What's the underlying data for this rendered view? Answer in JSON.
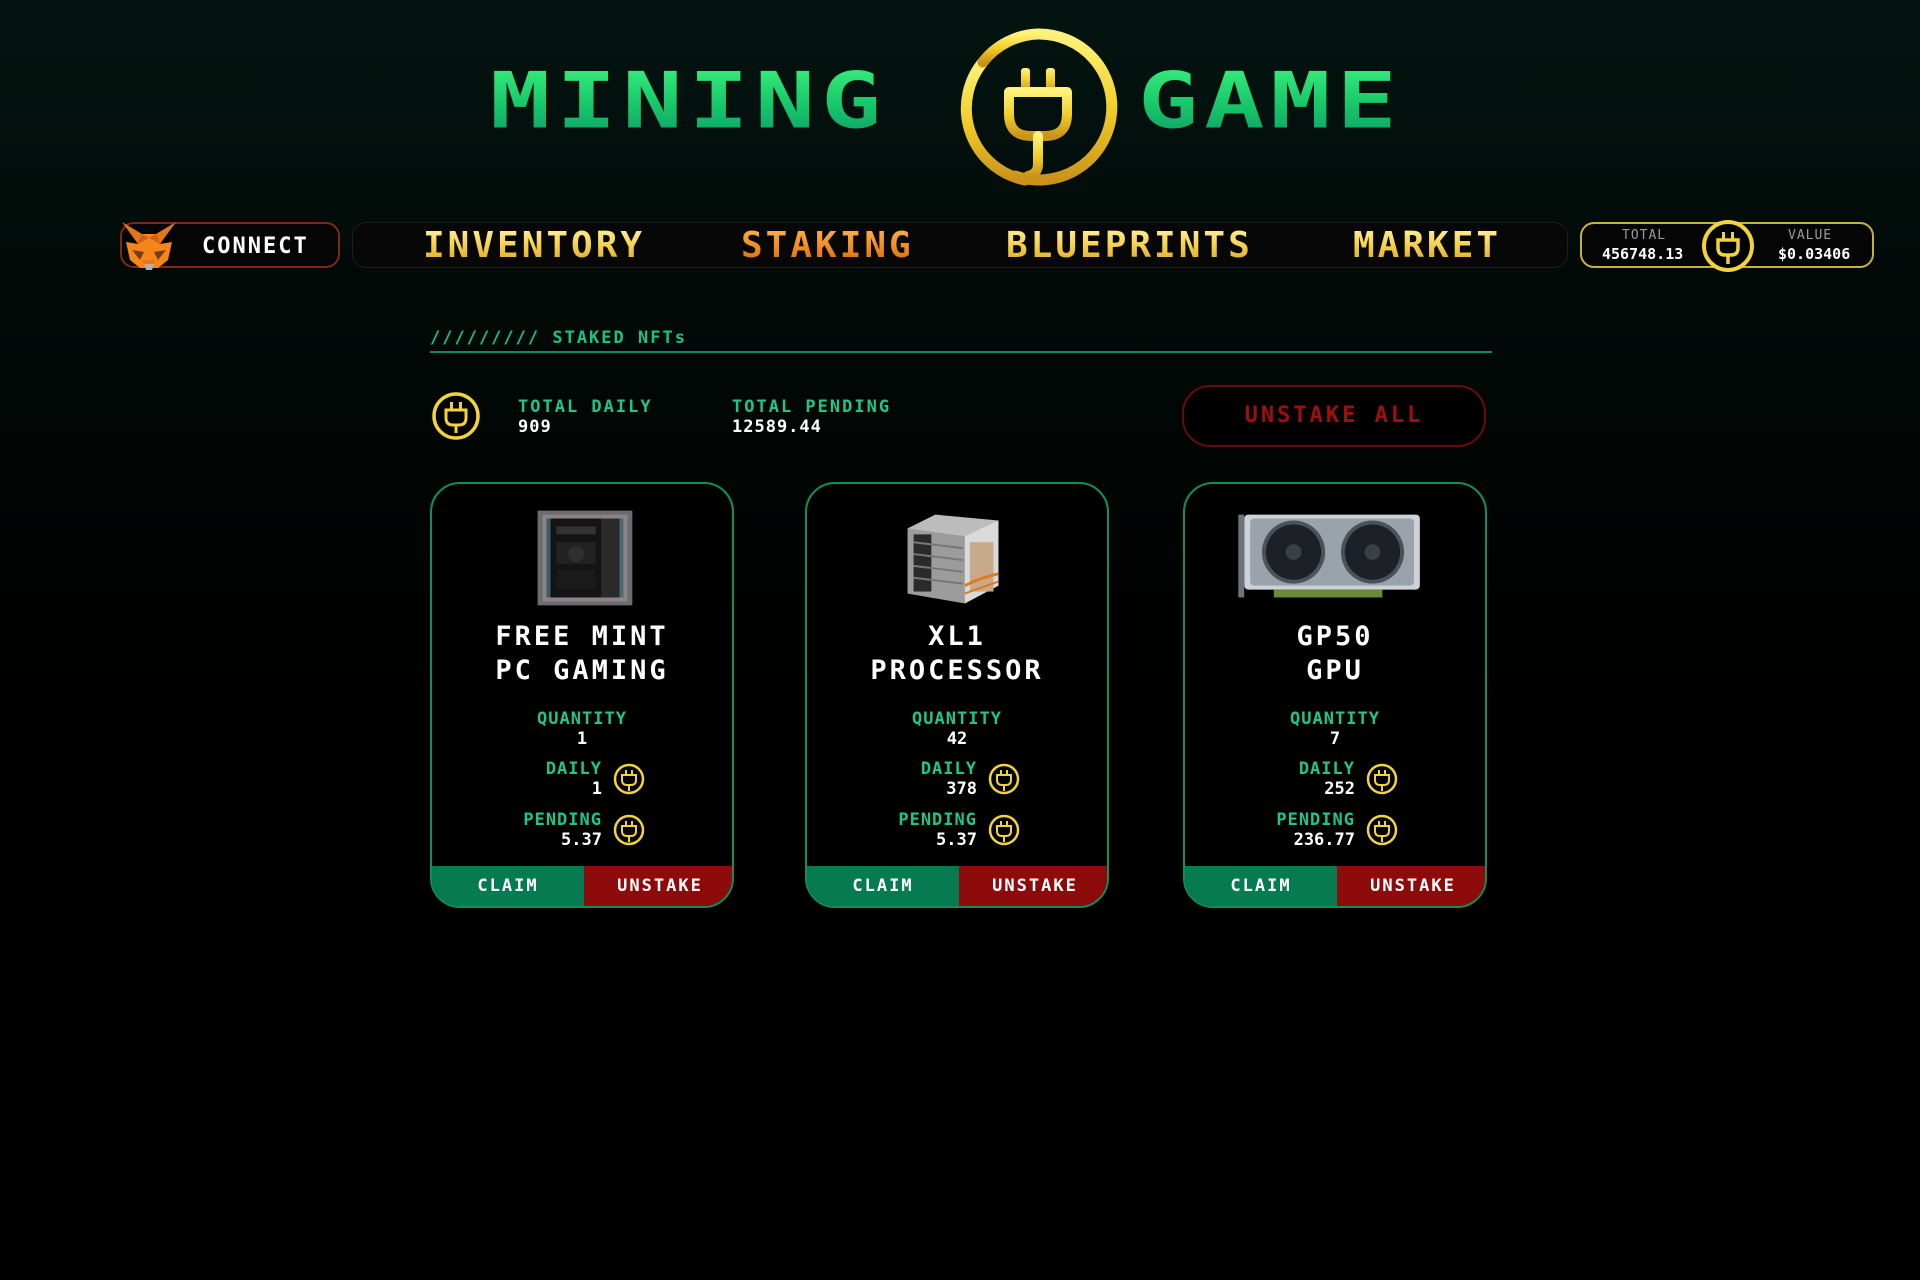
{
  "header": {
    "logo_left": "MINING",
    "logo_right": "GAME",
    "logo_icon": "plug-coin-icon"
  },
  "nav": {
    "connect_label": "CONNECT",
    "connect_icon": "metamask-fox-icon",
    "items": [
      {
        "label": "INVENTORY",
        "active": false
      },
      {
        "label": "STAKING",
        "active": true
      },
      {
        "label": "BLUEPRINTS",
        "active": false
      },
      {
        "label": "MARKET",
        "active": false
      }
    ],
    "wallet": {
      "total_label": "TOTAL",
      "total_value": "456748.13",
      "value_label": "VALUE",
      "value_value": "$0.03406"
    }
  },
  "section": {
    "title": "///////// STAKED NFTs",
    "total_daily_label": "TOTAL DAILY",
    "total_daily_value": "909",
    "total_pending_label": "TOTAL PENDING",
    "total_pending_value": "12589.44",
    "unstake_all_label": "UNSTAKE ALL"
  },
  "cards": [
    {
      "title_line1": "FREE MINT",
      "title_line2": "PC GAMING",
      "image": "pc-case-image",
      "quantity_label": "QUANTITY",
      "quantity": "1",
      "daily_label": "DAILY",
      "daily": "1",
      "pending_label": "PENDING",
      "pending": "5.37",
      "claim_label": "CLAIM",
      "unstake_label": "UNSTAKE"
    },
    {
      "title_line1": "XL1",
      "title_line2": "PROCESSOR",
      "image": "cpu-cooler-image",
      "quantity_label": "QUANTITY",
      "quantity": "42",
      "daily_label": "DAILY",
      "daily": "378",
      "pending_label": "PENDING",
      "pending": "5.37",
      "claim_label": "CLAIM",
      "unstake_label": "UNSTAKE"
    },
    {
      "title_line1": "GP50",
      "title_line2": "GPU",
      "image": "gpu-card-image",
      "quantity_label": "QUANTITY",
      "quantity": "7",
      "daily_label": "DAILY",
      "daily": "252",
      "pending_label": "PENDING",
      "pending": "236.77",
      "claim_label": "CLAIM",
      "unstake_label": "UNSTAKE"
    }
  ],
  "colors": {
    "accent_green": "#1ec689",
    "gold": "#f2d060",
    "active_orange": "#f08a1c",
    "danger_red": "#8e0b0b",
    "claim_green": "#067a50"
  }
}
